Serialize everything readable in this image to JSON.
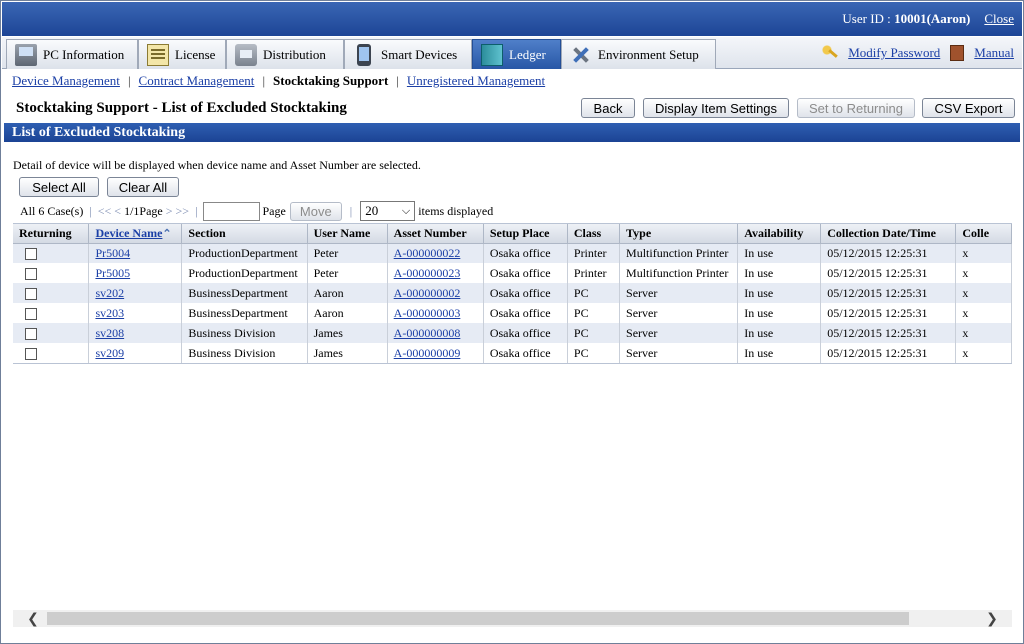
{
  "header": {
    "user_label": "User ID :",
    "user_value": "10001(Aaron)",
    "close_label": "Close"
  },
  "tabs": [
    {
      "label": "PC Information",
      "icon": "pc-icon"
    },
    {
      "label": "License",
      "icon": "license-icon"
    },
    {
      "label": "Distribution",
      "icon": "distribution-icon"
    },
    {
      "label": "Smart Devices",
      "icon": "smartphone-icon"
    },
    {
      "label": "Ledger",
      "icon": "ledger-icon",
      "active": true
    },
    {
      "label": "Environment Setup",
      "icon": "tools-icon"
    }
  ],
  "toplinks": {
    "modify_password": "Modify Password",
    "manual": "Manual"
  },
  "subnav": {
    "device_management": "Device Management",
    "contract_management": "Contract Management",
    "stocktaking_support": "Stocktaking Support",
    "unregistered_management": "Unregistered Management"
  },
  "page_title": "Stocktaking Support - List of Excluded Stocktaking",
  "buttons": {
    "back": "Back",
    "display_item_settings": "Display Item Settings",
    "set_to_returning": "Set to Returning",
    "csv_export": "CSV Export",
    "select_all": "Select All",
    "clear_all": "Clear All",
    "move": "Move"
  },
  "section_title": "List of Excluded Stocktaking",
  "detail_text": "Detail of device will be displayed when device name and Asset Number are selected.",
  "pager": {
    "count": "All 6 Case(s)",
    "first": "<<",
    "prev": "<",
    "page_info": "1/1Page",
    "next": ">",
    "last": ">>",
    "page_label": "Page",
    "page_value": "",
    "per_page": "20",
    "items_label": "items displayed"
  },
  "table": {
    "columns": [
      "Returning",
      "Device Name",
      "Section",
      "User Name",
      "Asset Number",
      "Setup Place",
      "Class",
      "Type",
      "Availability",
      "Collection Date/Time",
      "Colle"
    ],
    "rows": [
      {
        "device": "Pr5004",
        "section": "ProductionDepartment",
        "user": "Peter",
        "asset": "A-000000022",
        "place": "Osaka office",
        "class": "Printer",
        "type": "Multifunction Printer",
        "availability": "In use",
        "collected": "05/12/2015 12:25:31",
        "extra": "x"
      },
      {
        "device": "Pr5005",
        "section": "ProductionDepartment",
        "user": "Peter",
        "asset": "A-000000023",
        "place": "Osaka office",
        "class": "Printer",
        "type": "Multifunction Printer",
        "availability": "In use",
        "collected": "05/12/2015 12:25:31",
        "extra": "x"
      },
      {
        "device": "sv202",
        "section": "BusinessDepartment",
        "user": "Aaron",
        "asset": "A-000000002",
        "place": "Osaka office",
        "class": "PC",
        "type": "Server",
        "availability": "In use",
        "collected": "05/12/2015 12:25:31",
        "extra": "x"
      },
      {
        "device": "sv203",
        "section": "BusinessDepartment",
        "user": "Aaron",
        "asset": "A-000000003",
        "place": "Osaka office",
        "class": "PC",
        "type": "Server",
        "availability": "In use",
        "collected": "05/12/2015 12:25:31",
        "extra": "x"
      },
      {
        "device": "sv208",
        "section": "Business Division",
        "user": "James",
        "asset": "A-000000008",
        "place": "Osaka office",
        "class": "PC",
        "type": "Server",
        "availability": "In use",
        "collected": "05/12/2015 12:25:31",
        "extra": "x"
      },
      {
        "device": "sv209",
        "section": "Business Division",
        "user": "James",
        "asset": "A-000000009",
        "place": "Osaka office",
        "class": "PC",
        "type": "Server",
        "availability": "In use",
        "collected": "05/12/2015 12:25:31",
        "extra": "x"
      }
    ]
  },
  "scrollbar": {
    "left_icon": "chevron-left-icon",
    "right_icon": "chevron-right-icon"
  }
}
